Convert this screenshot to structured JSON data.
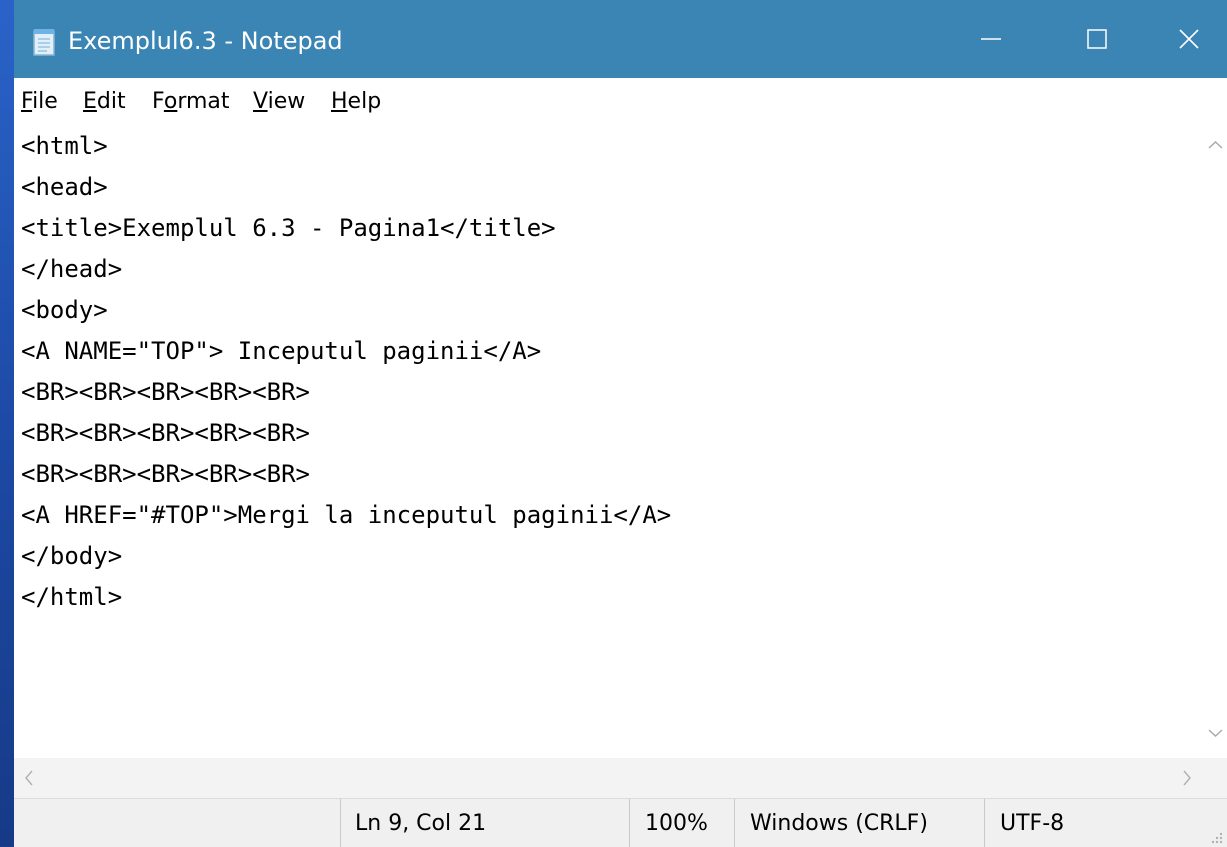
{
  "window": {
    "title": "Exemplul6.3 - Notepad"
  },
  "menu": {
    "file": {
      "first": "F",
      "rest": "ile"
    },
    "edit": {
      "first": "E",
      "rest": "dit"
    },
    "format": {
      "pre": "F",
      "first": "o",
      "rest": "rmat"
    },
    "view": {
      "first": "V",
      "rest": "iew"
    },
    "help": {
      "first": "H",
      "rest": "elp"
    }
  },
  "editor": {
    "lines": [
      "<html>",
      "<head>",
      "<title>Exemplul 6.3 - Pagina1</title>",
      "</head>",
      "<body>",
      "<A NAME=\"TOP\"> Inceputul paginii</A>",
      "<BR><BR><BR><BR><BR>",
      "<BR><BR><BR><BR><BR>",
      "<BR><BR><BR><BR><BR>",
      "<A HREF=\"#TOP\">Mergi la inceputul paginii</A>",
      "</body>",
      "</html>"
    ]
  },
  "status": {
    "position": "Ln 9, Col 21",
    "zoom": "100%",
    "line_ending": "Windows (CRLF)",
    "encoding": "UTF-8"
  },
  "icons": {
    "app": "notepad-icon",
    "minimize": "minimize-icon",
    "maximize": "maximize-icon",
    "close": "close-icon",
    "scroll_up": "scroll-up-arrow-icon",
    "scroll_down": "scroll-down-arrow-icon",
    "scroll_left": "scroll-left-arrow-icon",
    "scroll_right": "scroll-right-arrow-icon",
    "resize": "resize-grip-icon"
  },
  "colors": {
    "titlebar": "#3a85b4",
    "desktop": "#1b3f8f",
    "statusbar": "#f0f0f0"
  }
}
